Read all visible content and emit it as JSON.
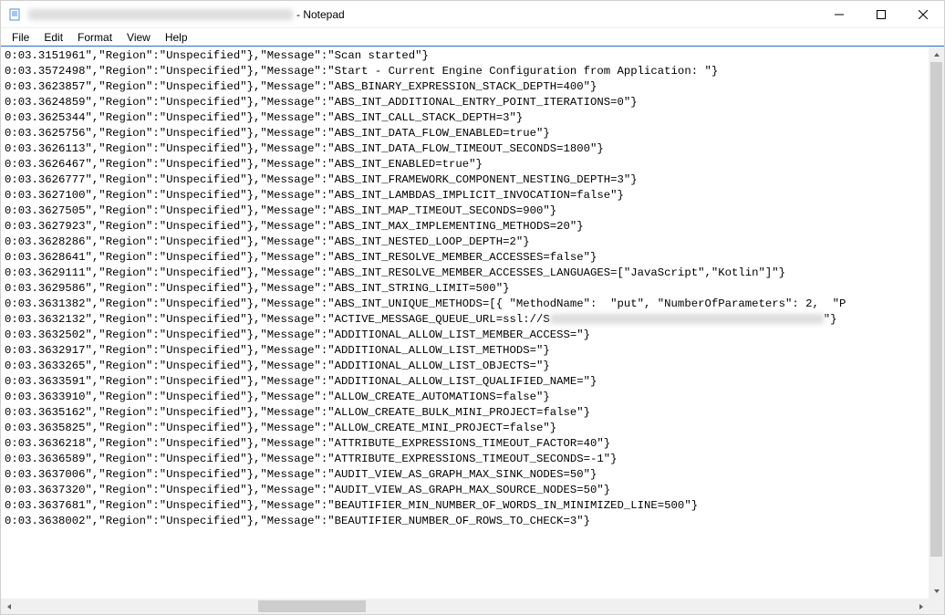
{
  "window": {
    "title_redacted_prefix": true,
    "title_suffix": " - Notepad"
  },
  "menu": {
    "file": "File",
    "edit": "Edit",
    "format": "Format",
    "view": "View",
    "help": "Help"
  },
  "lines": [
    {
      "ts": "0:03.3151961",
      "text": "\",\"Region\":\"Unspecified\"},\"Message\":\"Scan started\"}"
    },
    {
      "ts": "0:03.3572498",
      "text": "\",\"Region\":\"Unspecified\"},\"Message\":\"Start - Current Engine Configuration from Application: \"}"
    },
    {
      "ts": "0:03.3623857",
      "text": "\",\"Region\":\"Unspecified\"},\"Message\":\"ABS_BINARY_EXPRESSION_STACK_DEPTH=400\"}"
    },
    {
      "ts": "0:03.3624859",
      "text": "\",\"Region\":\"Unspecified\"},\"Message\":\"ABS_INT_ADDITIONAL_ENTRY_POINT_ITERATIONS=0\"}"
    },
    {
      "ts": "0:03.3625344",
      "text": "\",\"Region\":\"Unspecified\"},\"Message\":\"ABS_INT_CALL_STACK_DEPTH=3\"}"
    },
    {
      "ts": "0:03.3625756",
      "text": "\",\"Region\":\"Unspecified\"},\"Message\":\"ABS_INT_DATA_FLOW_ENABLED=true\"}"
    },
    {
      "ts": "0:03.3626113",
      "text": "\",\"Region\":\"Unspecified\"},\"Message\":\"ABS_INT_DATA_FLOW_TIMEOUT_SECONDS=1800\"}"
    },
    {
      "ts": "0:03.3626467",
      "text": "\",\"Region\":\"Unspecified\"},\"Message\":\"ABS_INT_ENABLED=true\"}"
    },
    {
      "ts": "0:03.3626777",
      "text": "\",\"Region\":\"Unspecified\"},\"Message\":\"ABS_INT_FRAMEWORK_COMPONENT_NESTING_DEPTH=3\"}"
    },
    {
      "ts": "0:03.3627100",
      "text": "\",\"Region\":\"Unspecified\"},\"Message\":\"ABS_INT_LAMBDAS_IMPLICIT_INVOCATION=false\"}"
    },
    {
      "ts": "0:03.3627505",
      "text": "\",\"Region\":\"Unspecified\"},\"Message\":\"ABS_INT_MAP_TIMEOUT_SECONDS=900\"}"
    },
    {
      "ts": "0:03.3627923",
      "text": "\",\"Region\":\"Unspecified\"},\"Message\":\"ABS_INT_MAX_IMPLEMENTING_METHODS=20\"}"
    },
    {
      "ts": "0:03.3628286",
      "text": "\",\"Region\":\"Unspecified\"},\"Message\":\"ABS_INT_NESTED_LOOP_DEPTH=2\"}"
    },
    {
      "ts": "0:03.3628641",
      "text": "\",\"Region\":\"Unspecified\"},\"Message\":\"ABS_INT_RESOLVE_MEMBER_ACCESSES=false\"}"
    },
    {
      "ts": "0:03.3629111",
      "text": "\",\"Region\":\"Unspecified\"},\"Message\":\"ABS_INT_RESOLVE_MEMBER_ACCESSES_LANGUAGES=[\"JavaScript\",\"Kotlin\"]\"}"
    },
    {
      "ts": "0:03.3629586",
      "text": "\",\"Region\":\"Unspecified\"},\"Message\":\"ABS_INT_STRING_LIMIT=500\"}"
    },
    {
      "ts": "0:03.3631382",
      "text": "\",\"Region\":\"Unspecified\"},\"Message\":\"ABS_INT_UNIQUE_METHODS=[{ \"MethodName\":  \"put\", \"NumberOfParameters\": 2,  \"P"
    },
    {
      "ts": "0:03.3632132",
      "text": "\",\"Region\":\"Unspecified\"},\"Message\":\"ACTIVE_MESSAGE_QUEUE_URL=ssl://S",
      "blur_width": 300,
      "suffix": "\"}"
    },
    {
      "ts": "0:03.3632502",
      "text": "\",\"Region\":\"Unspecified\"},\"Message\":\"ADDITIONAL_ALLOW_LIST_MEMBER_ACCESS=\"}"
    },
    {
      "ts": "0:03.3632917",
      "text": "\",\"Region\":\"Unspecified\"},\"Message\":\"ADDITIONAL_ALLOW_LIST_METHODS=\"}"
    },
    {
      "ts": "0:03.3633265",
      "text": "\",\"Region\":\"Unspecified\"},\"Message\":\"ADDITIONAL_ALLOW_LIST_OBJECTS=\"}"
    },
    {
      "ts": "0:03.3633591",
      "text": "\",\"Region\":\"Unspecified\"},\"Message\":\"ADDITIONAL_ALLOW_LIST_QUALIFIED_NAME=\"}"
    },
    {
      "ts": "0:03.3633910",
      "text": "\",\"Region\":\"Unspecified\"},\"Message\":\"ALLOW_CREATE_AUTOMATIONS=false\"}"
    },
    {
      "ts": "0:03.3635162",
      "text": "\",\"Region\":\"Unspecified\"},\"Message\":\"ALLOW_CREATE_BULK_MINI_PROJECT=false\"}"
    },
    {
      "ts": "0:03.3635825",
      "text": "\",\"Region\":\"Unspecified\"},\"Message\":\"ALLOW_CREATE_MINI_PROJECT=false\"}"
    },
    {
      "ts": "0:03.3636218",
      "text": "\",\"Region\":\"Unspecified\"},\"Message\":\"ATTRIBUTE_EXPRESSIONS_TIMEOUT_FACTOR=40\"}"
    },
    {
      "ts": "0:03.3636589",
      "text": "\",\"Region\":\"Unspecified\"},\"Message\":\"ATTRIBUTE_EXPRESSIONS_TIMEOUT_SECONDS=-1\"}"
    },
    {
      "ts": "0:03.3637006",
      "text": "\",\"Region\":\"Unspecified\"},\"Message\":\"AUDIT_VIEW_AS_GRAPH_MAX_SINK_NODES=50\"}"
    },
    {
      "ts": "0:03.3637320",
      "text": "\",\"Region\":\"Unspecified\"},\"Message\":\"AUDIT_VIEW_AS_GRAPH_MAX_SOURCE_NODES=50\"}"
    },
    {
      "ts": "0:03.3637681",
      "text": "\",\"Region\":\"Unspecified\"},\"Message\":\"BEAUTIFIER_MIN_NUMBER_OF_WORDS_IN_MINIMIZED_LINE=500\"}"
    },
    {
      "ts": "0:03.3638002",
      "text": "\",\"Region\":\"Unspecified\"},\"Message\":\"BEAUTIFIER_NUMBER_OF_ROWS_TO_CHECK=3\"}"
    }
  ],
  "scroll": {
    "v_thumb_top_pct": 0,
    "v_thumb_height_pct": 95,
    "h_thumb_left_pct": 27,
    "h_thumb_width_pct": 12
  }
}
